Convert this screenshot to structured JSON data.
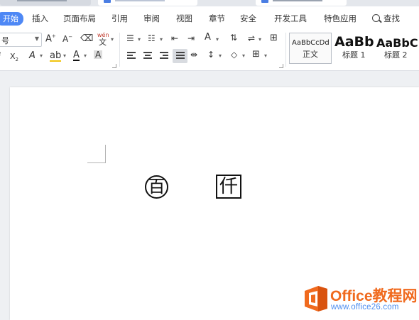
{
  "menubar": {
    "items": [
      "开始",
      "插入",
      "页面布局",
      "引用",
      "审阅",
      "视图",
      "章节",
      "安全",
      "开发工具",
      "特色应用"
    ],
    "search_label": "查找"
  },
  "ribbon": {
    "font_size_value": "号",
    "phonetic_label": "wén",
    "styles": [
      {
        "sample": "AaBbCcDd",
        "name": "正文"
      },
      {
        "sample": "AaBb",
        "name": "标题 1"
      },
      {
        "sample": "AaBbC",
        "name": "标题 2"
      }
    ]
  },
  "document": {
    "circle_char": "百",
    "square_char": "仟"
  },
  "watermark": {
    "title": "Office教程网",
    "url": "www.office26.com",
    "colors": {
      "title": "#f06a1e",
      "url": "#4e8ff0",
      "logo": "#f06a1e"
    }
  },
  "colors": {
    "accent": "#4e88f5",
    "page": "#ffffff",
    "canvas": "#eef0f3"
  }
}
